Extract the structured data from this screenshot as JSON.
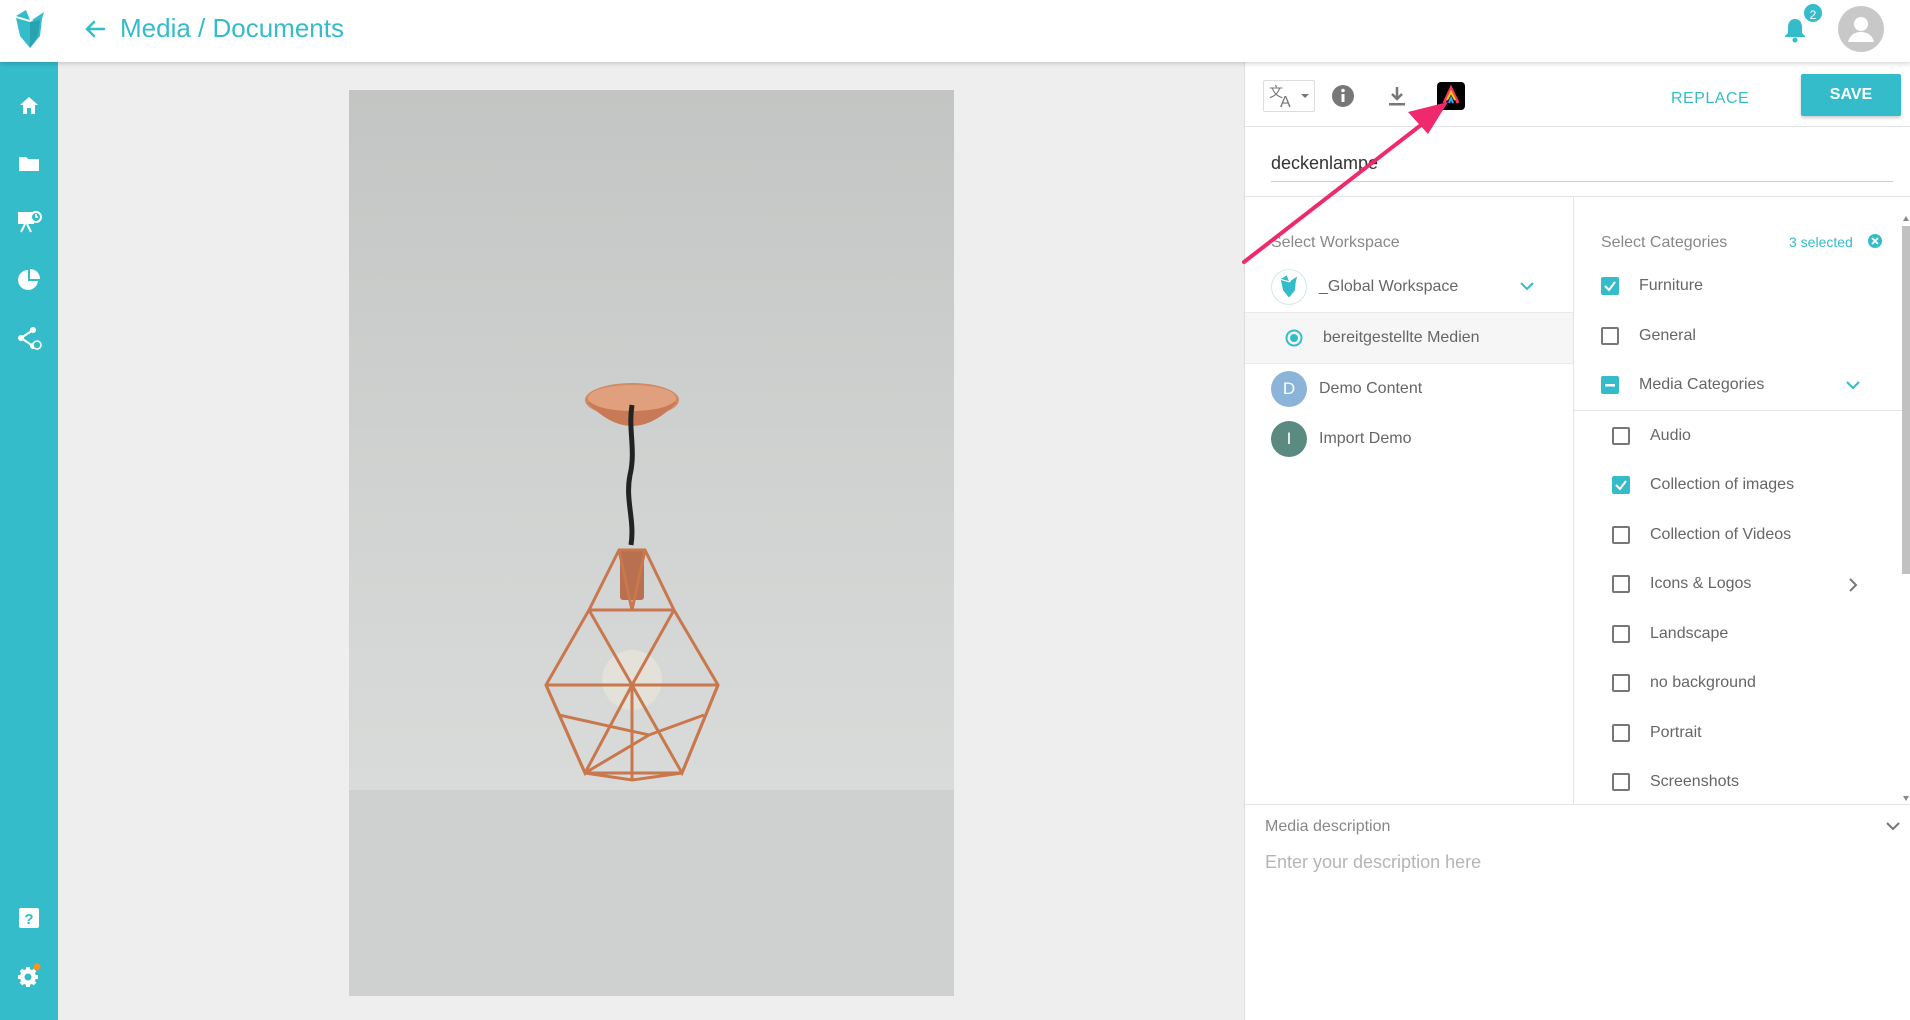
{
  "header": {
    "title": "Media / Documents",
    "notification_count": "2"
  },
  "sidebar": {
    "items": [
      {
        "icon": "home-icon"
      },
      {
        "icon": "folder-icon"
      },
      {
        "icon": "presentation-icon"
      },
      {
        "icon": "pie-chart-icon"
      },
      {
        "icon": "share-icon"
      },
      {
        "icon": "help-icon"
      },
      {
        "icon": "settings-icon"
      }
    ]
  },
  "toolbar": {
    "replace_label": "REPLACE",
    "save_label": "SAVE"
  },
  "media": {
    "title_value": "deckenlampe"
  },
  "workspace": {
    "label": "Select Workspace",
    "selected": "_Global Workspace",
    "sub_item": "bereitgestellte Medien",
    "others": [
      {
        "initial": "D",
        "name": "Demo Content",
        "color": "#8cb4d8"
      },
      {
        "initial": "I",
        "name": "Import Demo",
        "color": "#5a8a80"
      }
    ]
  },
  "categories": {
    "label": "Select Categories",
    "selected_count": "3 selected",
    "top_items": [
      {
        "name": "Furniture",
        "checked": true
      },
      {
        "name": "General",
        "checked": false
      },
      {
        "name": "Media Categories",
        "checked": "indeterminate"
      }
    ],
    "sub_items": [
      {
        "name": "Audio",
        "checked": false
      },
      {
        "name": "Collection of images",
        "checked": true
      },
      {
        "name": "Collection of Videos",
        "checked": false
      },
      {
        "name": "Icons & Logos",
        "checked": false
      },
      {
        "name": "Landscape",
        "checked": false
      },
      {
        "name": "no background",
        "checked": false
      },
      {
        "name": "Portrait",
        "checked": false
      },
      {
        "name": "Screenshots",
        "checked": false
      }
    ]
  },
  "description": {
    "label": "Media description",
    "placeholder": "Enter your description here"
  },
  "colors": {
    "accent": "#34bccb",
    "arrow": "#f0296e"
  }
}
